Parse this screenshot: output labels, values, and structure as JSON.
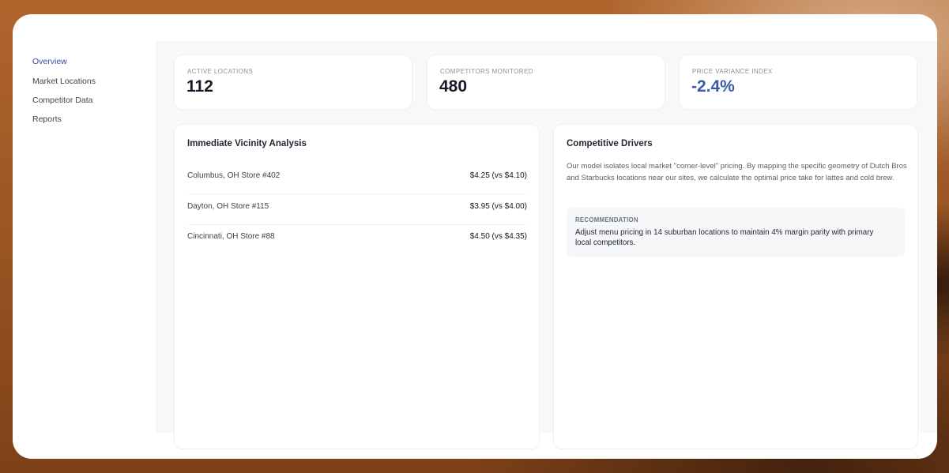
{
  "sidebar": {
    "items": [
      {
        "label": "Overview",
        "active": true
      },
      {
        "label": "Market Locations"
      },
      {
        "label": "Competitor Data"
      },
      {
        "label": "Reports"
      }
    ]
  },
  "kpis": [
    {
      "label": "ACTIVE LOCATIONS",
      "value": "112"
    },
    {
      "label": "COMPETITORS MONITORED",
      "value": "480"
    },
    {
      "label": "PRICE VARIANCE INDEX",
      "value": "-2.4%"
    }
  ],
  "vicinity": {
    "title": "Immediate Vicinity Analysis",
    "rows": [
      {
        "store": "Columbus, OH Store #402",
        "price": "$4.25 (vs $4.10)"
      },
      {
        "store": "Dayton, OH Store #115",
        "price": "$3.95 (vs $4.00)"
      },
      {
        "store": "Cincinnati, OH Store #88",
        "price": "$4.50 (vs $4.35)"
      }
    ]
  },
  "drivers": {
    "title": "Competitive Drivers",
    "description": "Our model isolates local market \"corner-level\" pricing. By mapping the specific geometry of Dutch Bros and Starbucks locations near our sites, we calculate the optimal price take for lattes and cold brew.",
    "recommendation_label": "RECOMMENDATION",
    "recommendation_text": "Adjust menu pricing in 14 suburban locations to maintain 4% margin parity with primary local competitors."
  },
  "colors": {
    "accent": "#3a5aa8",
    "nav_active": "#2f4fa3"
  }
}
